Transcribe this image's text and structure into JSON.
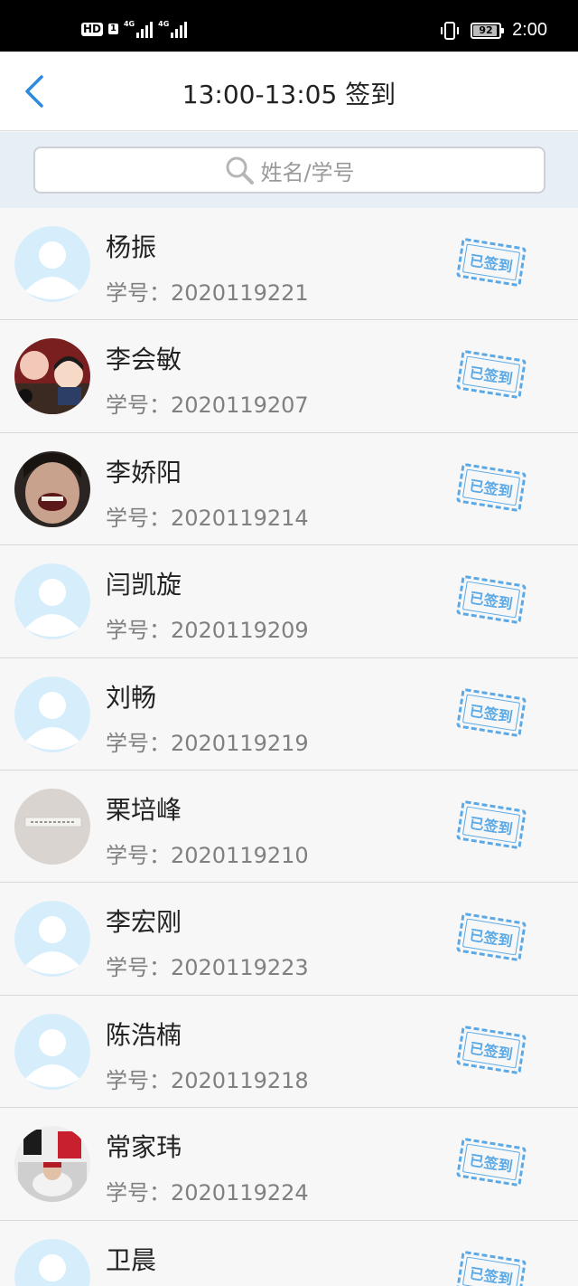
{
  "status_bar": {
    "hd": "HD",
    "sim": "1",
    "net1": "4G",
    "net2": "4G",
    "battery": "92",
    "time": "2:00",
    "icons": [
      "vibrate-icon",
      "battery-icon",
      "signal-icon"
    ]
  },
  "header": {
    "title": "13:00-13:05 签到",
    "back_icon": "chevron-left-icon",
    "accent": "#2d8ae0"
  },
  "search": {
    "placeholder": "姓名/学号"
  },
  "students": [
    {
      "name": "杨振",
      "id": "学号：2020119221",
      "avatar": "default",
      "status": "已签到"
    },
    {
      "name": "李会敏",
      "id": "学号：2020119207",
      "avatar": "photo-anime",
      "status": "已签到"
    },
    {
      "name": "李娇阳",
      "id": "学号：2020119214",
      "avatar": "photo-face",
      "status": "已签到"
    },
    {
      "name": "闫凯旋",
      "id": "学号：2020119209",
      "avatar": "default",
      "status": "已签到"
    },
    {
      "name": "刘畅",
      "id": "学号：2020119219",
      "avatar": "default",
      "status": "已签到"
    },
    {
      "name": "栗培峰",
      "id": "学号：2020119210",
      "avatar": "photo-text",
      "status": "已签到"
    },
    {
      "name": "李宏刚",
      "id": "学号：2020119223",
      "avatar": "default",
      "status": "已签到"
    },
    {
      "name": "陈浩楠",
      "id": "学号：2020119218",
      "avatar": "default",
      "status": "已签到"
    },
    {
      "name": "常家玮",
      "id": "学号：2020119224",
      "avatar": "photo-jersey",
      "status": "已签到"
    },
    {
      "name": "卫晨",
      "id": "",
      "avatar": "default",
      "status": "已签到"
    }
  ],
  "colors": {
    "stamp": "#5aa9e6",
    "default_avatar": "#d6eefc"
  }
}
